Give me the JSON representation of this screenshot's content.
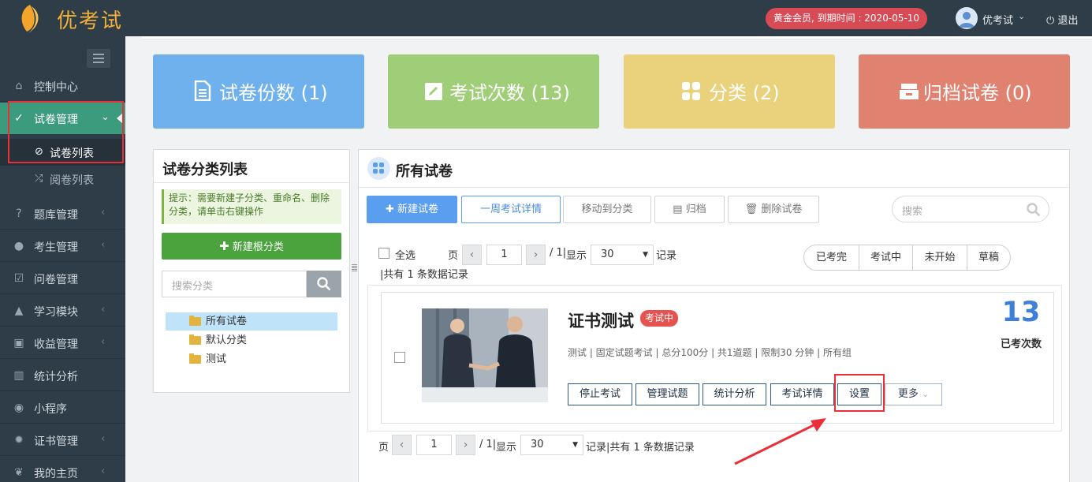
{
  "app": {
    "name": "优考试"
  },
  "header": {
    "member_badge": "黄金会员, 到期时间 : 2020-05-10",
    "user_name": "优考试",
    "logout": "退出"
  },
  "sidebar": {
    "items": [
      {
        "label": "控制中心",
        "icon": "home-icon"
      },
      {
        "label": "试卷管理",
        "icon": "check-circle-icon",
        "active": true
      },
      {
        "label": "题库管理",
        "icon": "question-circle-icon"
      },
      {
        "label": "考生管理",
        "icon": "user-icon"
      },
      {
        "label": "问卷管理",
        "icon": "checkbox-icon"
      },
      {
        "label": "学习模块",
        "icon": "graduation-cap-icon"
      },
      {
        "label": "收益管理",
        "icon": "money-icon"
      },
      {
        "label": "统计分析",
        "icon": "bar-chart-icon"
      },
      {
        "label": "小程序",
        "icon": "wechat-icon"
      },
      {
        "label": "证书管理",
        "icon": "certificate-icon"
      },
      {
        "label": "我的主页",
        "icon": "leaf-icon"
      }
    ],
    "sub_items": [
      {
        "label": "试卷列表",
        "icon": "check-circle-icon",
        "active": true
      },
      {
        "label": "阅卷列表",
        "icon": "shuffle-icon"
      }
    ]
  },
  "stats": [
    {
      "label": "试卷份数 (1)",
      "color": "#6eb1ec",
      "icon": "document-icon"
    },
    {
      "label": "考试次数 (13)",
      "color": "#a0cd78",
      "icon": "edit-icon"
    },
    {
      "label": "分类 (2)",
      "color": "#e9d27b",
      "icon": "grid-icon"
    },
    {
      "label": "归档试卷 (0)",
      "color": "#e0826f",
      "icon": "archive-icon"
    }
  ],
  "category_panel": {
    "title": "试卷分类列表",
    "tip": "提示：需要新建子分类、重命名、删除分类，请单击右键操作",
    "new_root_button": "新建根分类",
    "search_placeholder": "搜索分类",
    "tree": [
      "所有试卷",
      "默认分类",
      "测试"
    ]
  },
  "main_panel": {
    "title": "所有试卷",
    "toolbar": {
      "new": "新建试卷",
      "week": "一周考试详情",
      "move": "移动到分类",
      "archive": "归档",
      "delete": "删除试卷"
    },
    "search_placeholder": "搜索",
    "select_all": "全选",
    "pager": {
      "page_label": "页",
      "page": "1",
      "total_pages": "/ 1|",
      "show_label": "显示",
      "page_size": "30",
      "records_label": "记录",
      "summary": "|共有 1 条数据记录",
      "summary_bottom": "记录|共有 1 条数据记录"
    },
    "filters": [
      "已考完",
      "考试中",
      "未开始",
      "草稿"
    ],
    "exam": {
      "title": "证书测试",
      "status": "考试中",
      "meta": "测试 | 固定试题考试 | 总分100分 | 共1道题 | 限制30 分钟 | 所有组",
      "count": "13",
      "count_label": "已考次数",
      "actions": [
        "停止考试",
        "管理试题",
        "统计分析",
        "考试详情",
        "设置",
        "更多"
      ]
    }
  }
}
